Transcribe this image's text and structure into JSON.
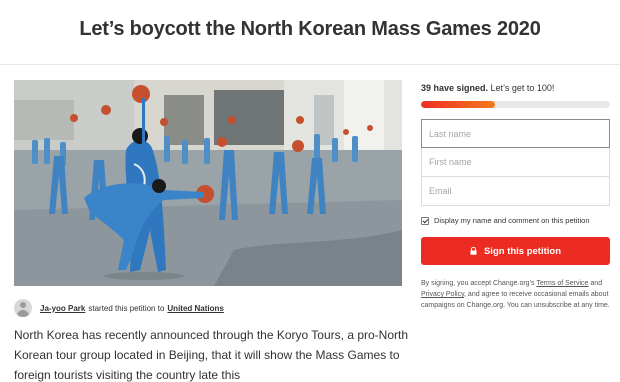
{
  "page": {
    "title": "Let’s boycott the North Korean Mass Games 2020"
  },
  "author": {
    "name": "Ja-yoo Park",
    "action_text": "started this petition to",
    "target": "United Nations"
  },
  "description": "North Korea has recently announced through the Koryo Tours, a pro-North Korean tour group located in Beijing, that it will show the Mass Games to foreign tourists visiting the country late this",
  "signatures": {
    "count_text": "39 have signed.",
    "goal_text": "Let’s get to 100!",
    "progress_fraction": 0.39
  },
  "form": {
    "last_name_placeholder": "Last name",
    "first_name_placeholder": "First name",
    "email_placeholder": "Email",
    "display_checkbox_label": "Display my name and comment on this petition",
    "display_checked": true,
    "sign_button_label": "Sign this petition"
  },
  "legal": {
    "part1": "By signing, you accept Change.org’s",
    "terms_link": "Terms of Service",
    "part2": "and",
    "privacy_link": "Privacy Policy",
    "part3": ", and agree to receive occasional emails about campaigns on Change.org. You can unsubscribe at any time."
  },
  "colors": {
    "accent_red": "#ec2c22",
    "progress_orange": "#f27a1a"
  },
  "icons": {
    "avatar": "user-avatar-placeholder",
    "sign_button": "lock-icon"
  }
}
